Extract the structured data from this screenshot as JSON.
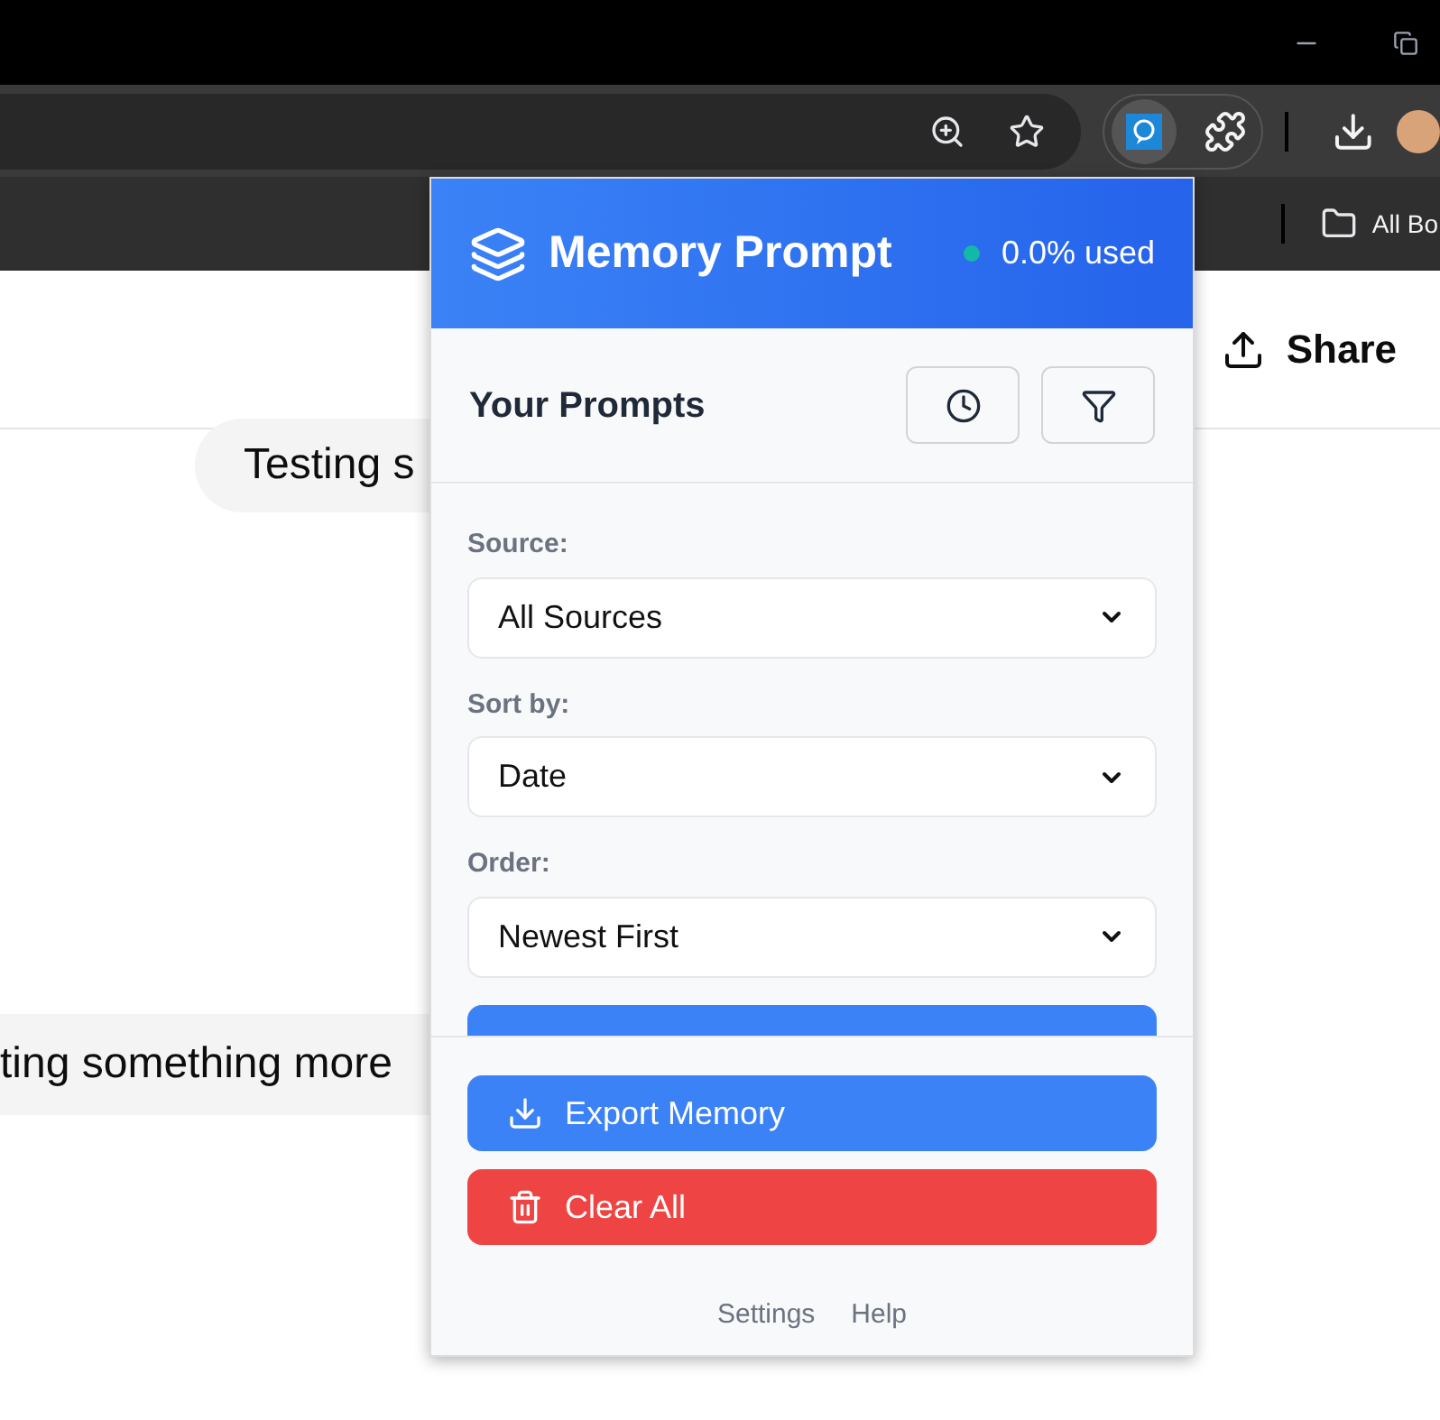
{
  "bookmarks_bar": {
    "folder": "All Bo"
  },
  "page": {
    "share_button": "Share",
    "messages": [
      "Testing s",
      "ting something more"
    ]
  },
  "popup": {
    "title": "Memory Prompt",
    "usage": "0.0% used",
    "section_title": "Your Prompts",
    "filters": [
      {
        "label": "Source:",
        "value": "All Sources"
      },
      {
        "label": "Sort by:",
        "value": "Date"
      },
      {
        "label": "Order:",
        "value": "Newest First"
      }
    ],
    "actions": [
      {
        "kind": "export",
        "label": "Export Memory"
      },
      {
        "kind": "clear",
        "label": "Clear All"
      }
    ],
    "links": [
      "Settings",
      "Help"
    ]
  }
}
